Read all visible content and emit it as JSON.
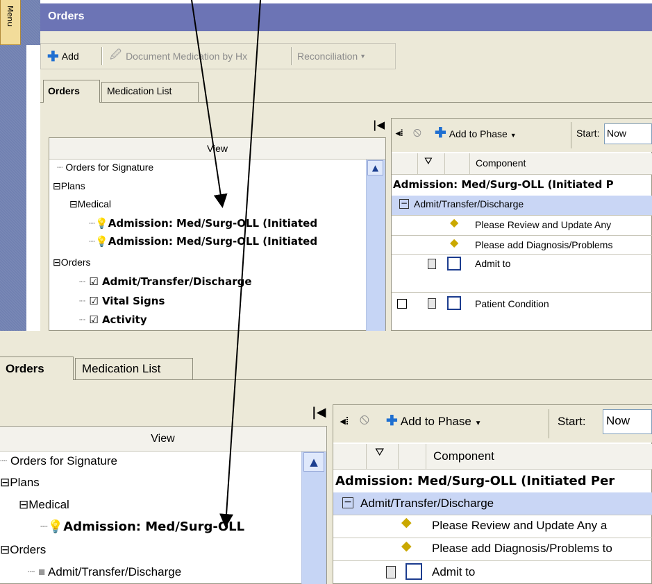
{
  "menu_tab": {
    "label": "Menu"
  },
  "window_title": "Orders",
  "toolbar": {
    "add_label": "Add",
    "document_med_label": "Document Medication by Hx",
    "reconciliation_label": "Reconciliation"
  },
  "tabs": {
    "orders": "Orders",
    "medication_list": "Medication List"
  },
  "tree": {
    "header": "View",
    "orders_for_signature": "Orders for Signature",
    "plans": "Plans",
    "medical": "Medical",
    "plan_1": "Admission: Med/Surg-OLL (Initiated",
    "plan_2": "Admission: Med/Surg-OLL (Initiated",
    "orders": "Orders",
    "admit": "Admit/Transfer/Discharge",
    "vital": "Vital Signs",
    "activity": "Activity"
  },
  "grid": {
    "add_to_phase": "Add to Phase",
    "start_label": "Start:",
    "start_value": "Now",
    "component_header": "Component",
    "plan_row": "Admission: Med/Surg-OLL (Initiated P",
    "section": "Admit/Transfer/Discharge",
    "row_review": "Please Review and Update Any",
    "row_diagnosis": "Please add Diagnosis/Problems",
    "row_admit": "Admit to",
    "row_condition": "Patient Condition"
  },
  "bottom_tabs": {
    "orders": "Orders",
    "medication_list": "Medication List"
  },
  "bottom_tree": {
    "header": "View",
    "orders_for_signature": "Orders for Signature",
    "plans": "Plans",
    "medical": "Medical",
    "plan_1": "Admission: Med/Surg-OLL",
    "orders": "Orders",
    "admit": "Admit/Transfer/Discharge"
  },
  "bottom_grid": {
    "add_to_phase": "Add to Phase",
    "start_label": "Start:",
    "start_value": "Now",
    "component_header": "Component",
    "plan_row": "Admission: Med/Surg-OLL (Initiated Per",
    "section": "Admit/Transfer/Discharge",
    "row_review": "Please Review and Update Any a",
    "row_diagnosis": "Please add Diagnosis/Problems to",
    "row_admit": "Admit to"
  },
  "colors": {
    "title_bar": "#6c74b5",
    "section_row": "#c9d6f5",
    "window_bg": "#ece9d8"
  }
}
